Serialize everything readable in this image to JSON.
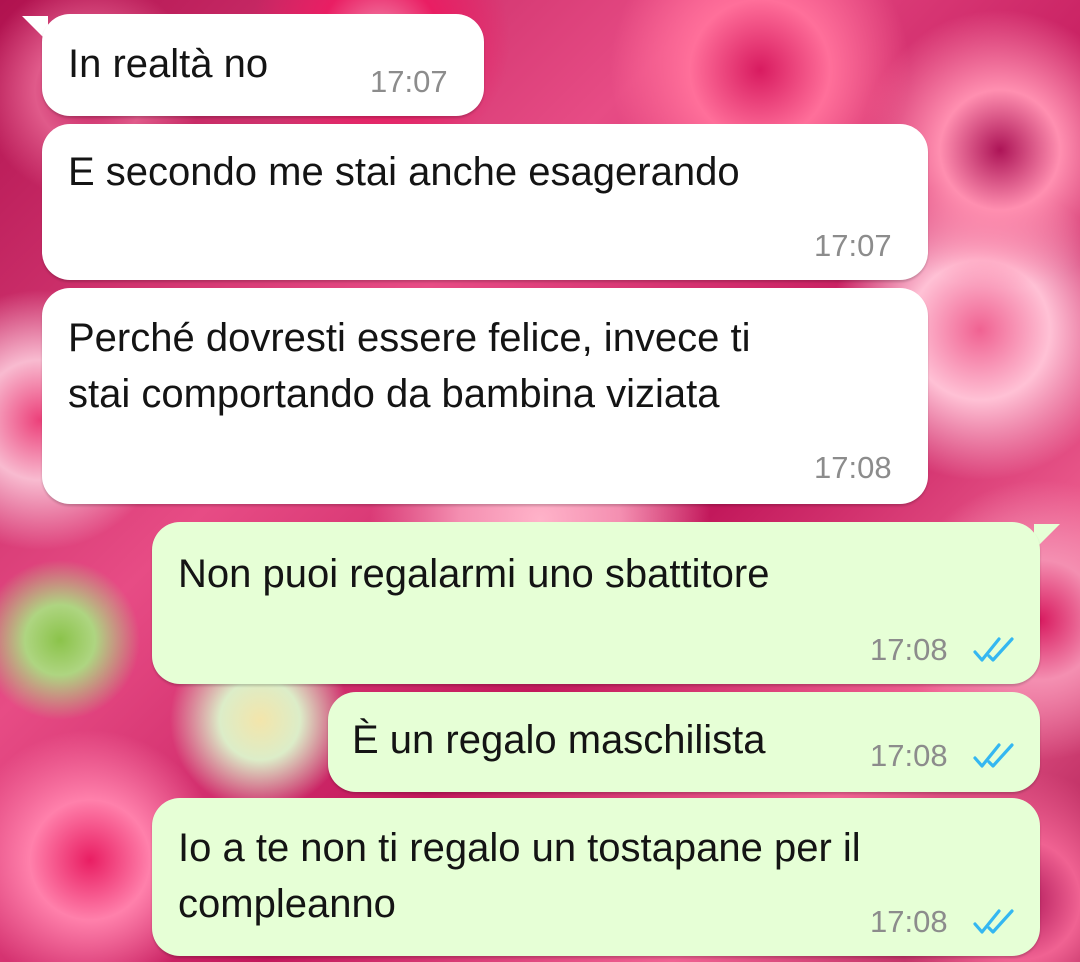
{
  "messages": [
    {
      "direction": "incoming",
      "text": "In realtà no",
      "time": "17:07"
    },
    {
      "direction": "incoming",
      "text": "E secondo me stai anche esagerando",
      "time": "17:07"
    },
    {
      "direction": "incoming",
      "text": "Perché dovresti essere felice, invece ti\nstai comportando da bambina viziata",
      "time": "17:08"
    },
    {
      "direction": "outgoing",
      "text": "Non puoi regalarmi uno sbattitore",
      "time": "17:08",
      "status": "read-double-check"
    },
    {
      "direction": "outgoing",
      "text": "È un regalo maschilista",
      "time": "17:08",
      "status": "read-double-check"
    },
    {
      "direction": "outgoing",
      "text": "Io a te non ti regalo un tostapane per il\ncompleanno",
      "time": "17:08",
      "status": "read-double-check"
    }
  ],
  "colors": {
    "incoming_bubble": "#ffffff",
    "outgoing_bubble": "#e6ffd6",
    "timestamp": "#8c8c8c",
    "read_ticks": "#34b7f1"
  },
  "wallpaper": "pink-roses"
}
